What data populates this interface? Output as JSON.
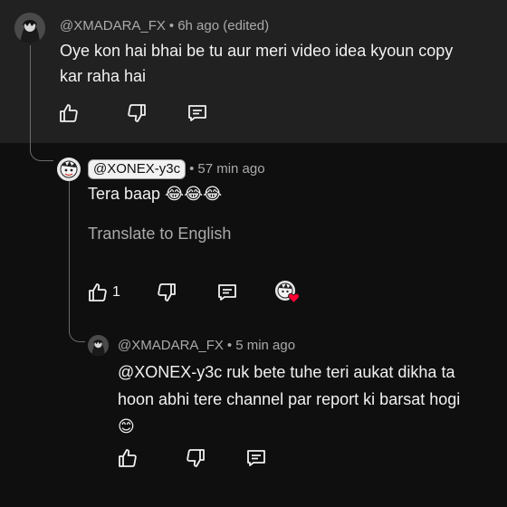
{
  "comment_top": {
    "handle": "@XMADARA_FX",
    "time": "6h ago (edited)",
    "text_line1": "Oye kon hai bhai be tu aur meri video idea kyoun copy",
    "text_line2": "kar raha hai"
  },
  "reply_1": {
    "handle": "@XONEX-y3c",
    "time": "57 min ago",
    "text": "Tera baap 😂😂😂",
    "translate_label": "Translate to English",
    "like_count": "1"
  },
  "reply_2": {
    "handle": "@XMADARA_FX",
    "time": "5 min ago",
    "text_line1": "@XONEX-y3c ruk bete tuhe teri aukat dikha ta",
    "text_line2": "hoon abhi tere channel par report ki barsat hogi",
    "text_line3": "😊"
  },
  "separator": "•",
  "icons": [
    "like-icon",
    "dislike-icon",
    "reply-icon",
    "creator-heart-icon"
  ],
  "colors": {
    "background": "#0f0f0f",
    "highlight_card": "#212121",
    "secondary_text": "#aaaaaa",
    "heart": "#ff0033"
  }
}
